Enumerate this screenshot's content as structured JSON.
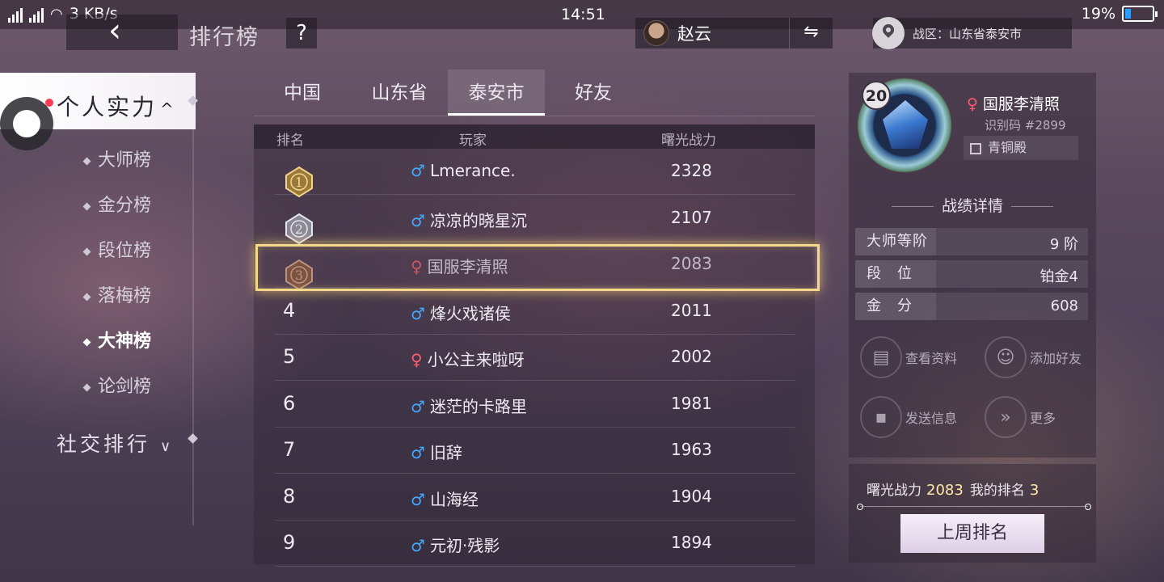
{
  "status_bar": {
    "network": "3G 3G",
    "speed": "3 KB/s",
    "time": "14:51",
    "battery": "19%",
    "battery_level": 0.19
  },
  "header": {
    "back_glyph": "‹",
    "title": "排行榜",
    "help_glyph": "?",
    "hero_name": "赵云",
    "swap_glyph": "⇋",
    "region": "战区：山东省泰安市"
  },
  "sidebar": {
    "active_group": "个人实力",
    "active_caret": "^",
    "items": [
      {
        "label": "大师榜",
        "current": false
      },
      {
        "label": "金分榜",
        "current": false
      },
      {
        "label": "段位榜",
        "current": false
      },
      {
        "label": "落梅榜",
        "current": false
      },
      {
        "label": "大神榜",
        "current": true
      },
      {
        "label": "论剑榜",
        "current": false
      }
    ],
    "social_group": "社交排行",
    "social_caret": "∨"
  },
  "tabs": [
    {
      "label": "中国",
      "active": false
    },
    {
      "label": "山东省",
      "active": false
    },
    {
      "label": "泰安市",
      "active": true
    },
    {
      "label": "好友",
      "active": false
    }
  ],
  "table": {
    "headers": {
      "rank": "排名",
      "player": "玩家",
      "power": "曙光战力"
    },
    "rows": [
      {
        "rank": "1",
        "gender": "♂",
        "name": "Lmerance.",
        "power": "2328",
        "medal": "gold"
      },
      {
        "rank": "2",
        "gender": "♂",
        "name": "凉凉的晓星沉",
        "power": "2107",
        "medal": "silver"
      },
      {
        "rank": "3",
        "gender": "♀",
        "name": "国服李清照",
        "power": "2083",
        "medal": "bronze"
      },
      {
        "rank": "4",
        "gender": "♂",
        "name": "烽火戏诸侯",
        "power": "2011",
        "medal": ""
      },
      {
        "rank": "5",
        "gender": "♀",
        "name": "小公主来啦呀",
        "power": "2002",
        "medal": ""
      },
      {
        "rank": "6",
        "gender": "♂",
        "name": "迷茫的卡路里",
        "power": "1981",
        "medal": ""
      },
      {
        "rank": "7",
        "gender": "♂",
        "name": "旧辞",
        "power": "1963",
        "medal": ""
      },
      {
        "rank": "8",
        "gender": "♂",
        "name": "山海经",
        "power": "1904",
        "medal": ""
      },
      {
        "rank": "9",
        "gender": "♂",
        "name": "元初·残影",
        "power": "1894",
        "medal": ""
      }
    ]
  },
  "profile": {
    "level": "20",
    "gender": "♀",
    "name": "国服李清照",
    "id_text": "识别码 #2899",
    "tier": "青铜殿",
    "section_title": "战绩详情",
    "stats": [
      {
        "label": "大师等阶",
        "value": "9 阶"
      },
      {
        "label": "段　位",
        "value": "铂金4"
      },
      {
        "label": "金　分",
        "value": "608"
      }
    ],
    "actions": [
      {
        "label": "查看资料",
        "icon": "profile-doc-icon"
      },
      {
        "label": "添加好友",
        "icon": "add-friend-icon"
      },
      {
        "label": "发送信息",
        "icon": "message-icon"
      },
      {
        "label": "更多",
        "icon": "more-chevrons-icon"
      }
    ]
  },
  "my_rank": {
    "power_label": "曙光战力",
    "power_value": "2083",
    "rank_label": "我的排名",
    "rank_value": "3",
    "button": "上周排名"
  },
  "colors": {
    "male": "#42a8ff",
    "female": "#ff5d6e",
    "highlight": "#f4d98a"
  }
}
